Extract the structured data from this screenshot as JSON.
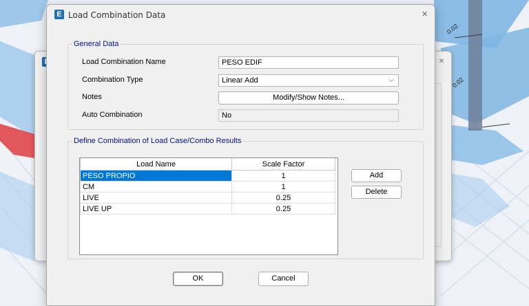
{
  "dialog": {
    "title": "Load Combination Data",
    "close_glyph": "×",
    "app_icon_letter": "E"
  },
  "general": {
    "legend": "General Data",
    "name_label": "Load Combination Name",
    "name_value": "PESO EDIF",
    "type_label": "Combination Type",
    "type_value": "Linear Add",
    "notes_label": "Notes",
    "notes_button": "Modify/Show Notes...",
    "auto_label": "Auto Combination",
    "auto_value": "No"
  },
  "define": {
    "legend": "Define Combination of Load Case/Combo Results",
    "columns": [
      "Load Name",
      "Scale Factor"
    ],
    "rows": [
      {
        "name": "PESO PROPIO",
        "factor": "1"
      },
      {
        "name": "CM",
        "factor": "1"
      },
      {
        "name": "LIVE",
        "factor": "0.25"
      },
      {
        "name": "LIVE UP",
        "factor": "0.25"
      }
    ],
    "add_button": "Add",
    "delete_button": "Delete"
  },
  "footer": {
    "ok_button": "OK",
    "cancel_button": "Cancel"
  },
  "viewport": {
    "labels": [
      "0.02",
      "0.02"
    ]
  },
  "colors": {
    "selection": "#0078d7",
    "legend_text": "#00118a",
    "slab_blue": "#7fb6e3",
    "column_grey": "#6f7f98",
    "red_member": "#e0464a"
  },
  "icons": {
    "close": "close-icon",
    "app": "etabs-app-icon",
    "dropdown": "chevron-down-icon"
  }
}
